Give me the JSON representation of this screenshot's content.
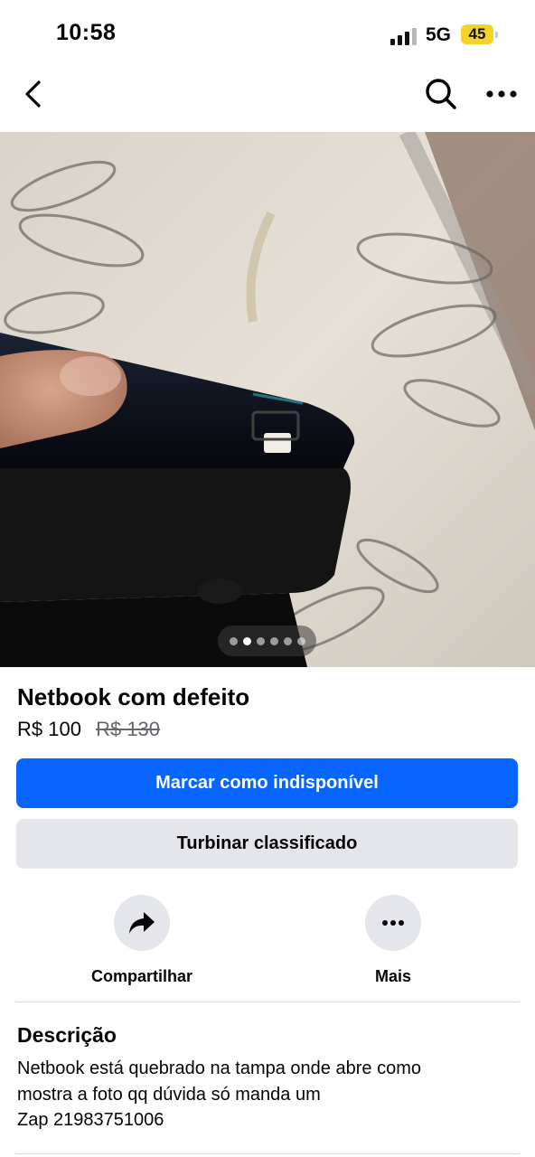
{
  "status_bar": {
    "time": "10:58",
    "network": "5G",
    "battery": "45"
  },
  "nav": {
    "back_icon": "chevron-left-icon",
    "search_icon": "search-icon",
    "more_icon": "more-horizontal-icon"
  },
  "gallery": {
    "image_count": 6,
    "active_index": 1
  },
  "listing": {
    "title": "Netbook com defeito",
    "price": "R$ 100",
    "original_price": "R$ 130"
  },
  "buttons": {
    "primary_label": "Marcar como indisponível",
    "secondary_label": "Turbinar classificado"
  },
  "actions": [
    {
      "label": "Compartilhar",
      "icon": "share-arrow-icon"
    },
    {
      "label": "Mais",
      "icon": "more-horizontal-icon"
    }
  ],
  "description": {
    "heading": "Descrição",
    "text": "Netbook está quebrado na tampa onde abre como\nmostra a foto qq dúvida só manda um\nZap 21983751006"
  },
  "colors": {
    "primary": "#0866ff",
    "secondary_bg": "#e4e6eb",
    "battery": "#f6d327"
  }
}
